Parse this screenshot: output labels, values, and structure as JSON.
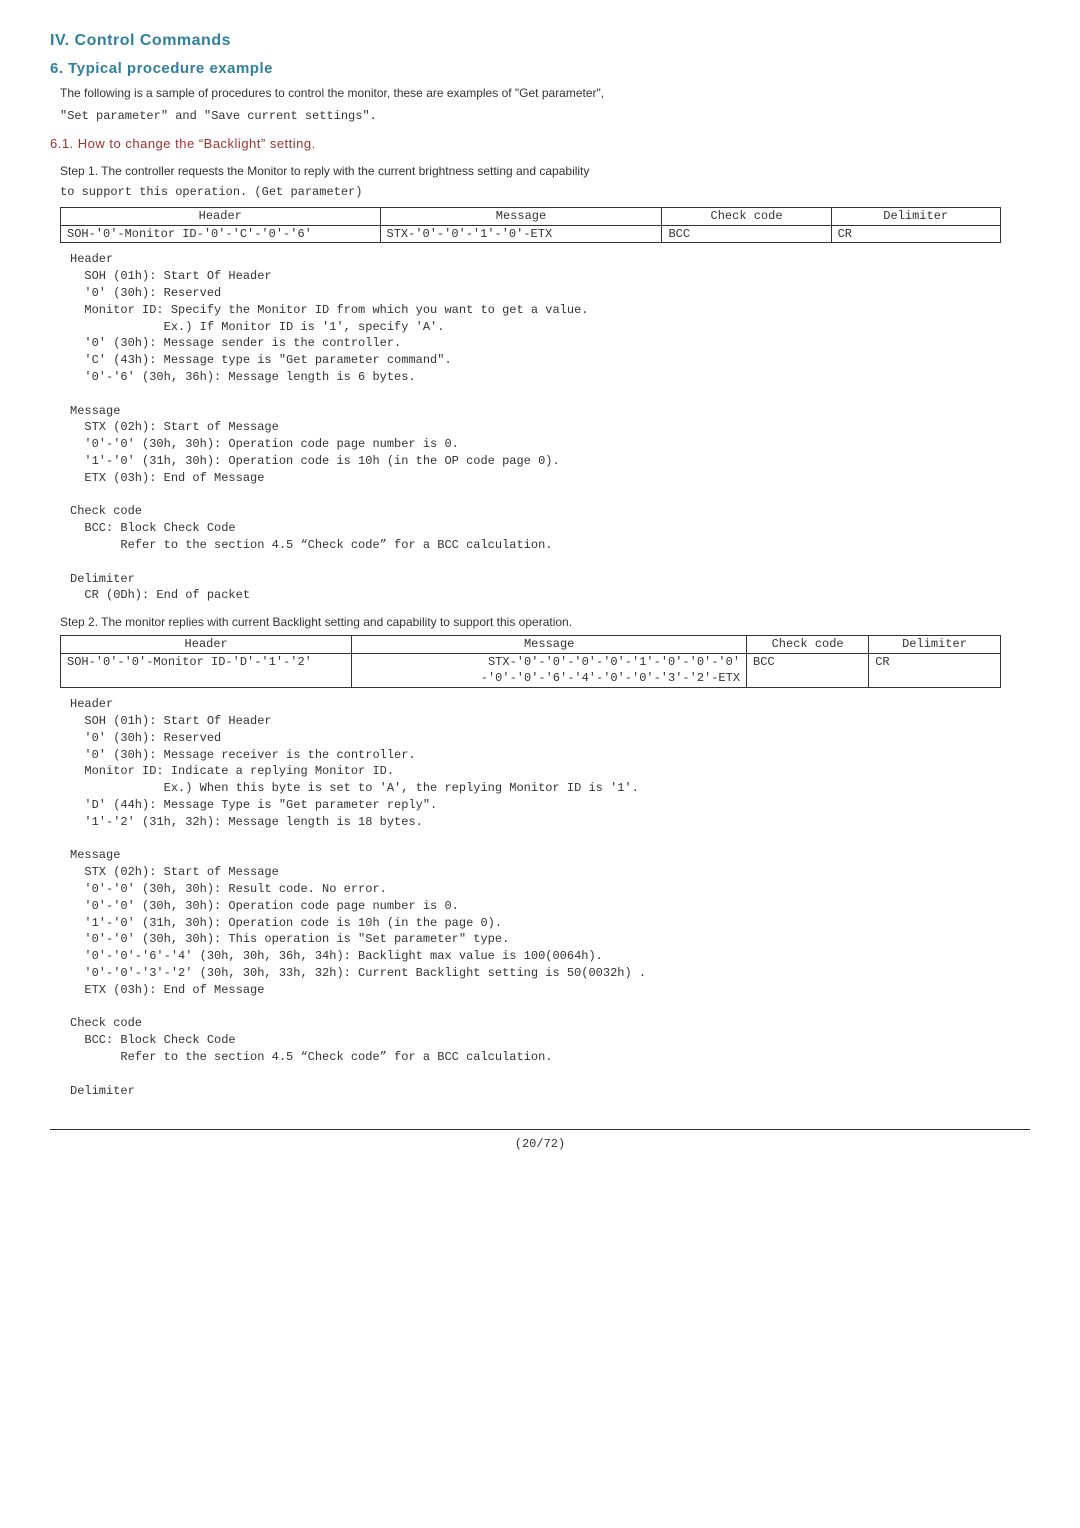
{
  "headings": {
    "h1": "IV. Control Commands",
    "h2": "6. Typical procedure example",
    "h3": "6.1. How to change the “Backlight” setting."
  },
  "intro1": "The following is a sample of procedures to control the monitor, these are examples of \"Get parameter\",",
  "intro2": " \"Set parameter\" and \"Save current settings\".",
  "step1": {
    "text1": "Step 1. The controller requests the Monitor to reply with the current brightness setting and capability",
    "text2": " to support this operation. (Get parameter)",
    "table": {
      "headers": [
        "Header",
        "Message",
        "Check code",
        "Delimiter"
      ],
      "row": [
        "SOH-'0'-Monitor ID-'0'-'C'-'0'-'6'",
        "STX-'0'-'0'-'1'-'0'-ETX",
        "BCC",
        "CR"
      ]
    },
    "block": "Header\n  SOH (01h): Start Of Header\n  '0' (30h): Reserved\n  Monitor ID: Specify the Monitor ID from which you want to get a value.\n             Ex.) If Monitor ID is '1', specify 'A'.\n  '0' (30h): Message sender is the controller.\n  'C' (43h): Message type is \"Get parameter command\".\n  '0'-'6' (30h, 36h): Message length is 6 bytes.\n\nMessage\n  STX (02h): Start of Message\n  '0'-'0' (30h, 30h): Operation code page number is 0.\n  '1'-'0' (31h, 30h): Operation code is 10h (in the OP code page 0).\n  ETX (03h): End of Message\n\nCheck code\n  BCC: Block Check Code\n       Refer to the section 4.5 “Check code” for a BCC calculation.\n\nDelimiter\n  CR (0Dh): End of packet"
  },
  "step2": {
    "text1": "Step 2. The monitor replies with current Backlight setting and capability to support this operation.",
    "table": {
      "headers": [
        "Header",
        "Message",
        "Check code",
        "Delimiter"
      ],
      "row": [
        "SOH-'0'-'0'-Monitor ID-'D'-'1'-'2'",
        "STX-'0'-'0'-'0'-'0'-'1'-'0'-'0'-'0'\n-'0'-'0'-'6'-'4'-'0'-'0'-'3'-'2'-ETX",
        "BCC",
        "CR"
      ]
    },
    "block": "Header\n  SOH (01h): Start Of Header\n  '0' (30h): Reserved\n  '0' (30h): Message receiver is the controller.\n  Monitor ID: Indicate a replying Monitor ID.\n             Ex.) When this byte is set to 'A', the replying Monitor ID is '1'.\n  'D' (44h): Message Type is \"Get parameter reply\".\n  '1'-'2' (31h, 32h): Message length is 18 bytes.\n\nMessage\n  STX (02h): Start of Message\n  '0'-'0' (30h, 30h): Result code. No error.\n  '0'-'0' (30h, 30h): Operation code page number is 0.\n  '1'-'0' (31h, 30h): Operation code is 10h (in the page 0).\n  '0'-'0' (30h, 30h): This operation is \"Set parameter\" type.\n  '0'-'0'-'6'-'4' (30h, 30h, 36h, 34h): Backlight max value is 100(0064h).\n  '0'-'0'-'3'-'2' (30h, 30h, 33h, 32h): Current Backlight setting is 50(0032h) .\n  ETX (03h): End of Message\n\nCheck code\n  BCC: Block Check Code\n       Refer to the section 4.5 “Check code” for a BCC calculation.\n\nDelimiter"
  },
  "footer": "(20/72)"
}
